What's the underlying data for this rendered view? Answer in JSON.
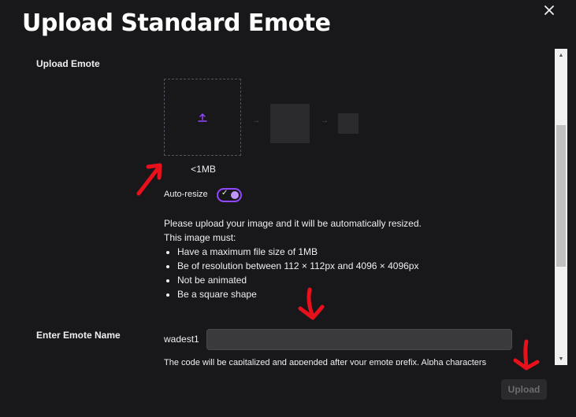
{
  "modal": {
    "title": "Upload Standard Emote",
    "close_icon": "close-icon"
  },
  "upload_section": {
    "label": "Upload Emote",
    "upload_icon": "upload-arrow-icon",
    "size_limit": "<1MB",
    "auto_resize": {
      "label": "Auto-resize",
      "enabled": true,
      "check_icon": "checkmark-icon"
    },
    "instructions": {
      "intro": "Please upload your image and it will be automatically resized.",
      "must_heading": "This image must:",
      "requirements": [
        "Have a maximum file size of 1MB",
        "Be of resolution between 112 × 112px and 4096 × 4096px",
        "Not be animated",
        "Be a square shape"
      ]
    }
  },
  "name_section": {
    "label": "Enter Emote Name",
    "prefix": "wadest1",
    "value": "",
    "placeholder": "",
    "help_text": "The code will be capitalized and appended after your emote prefix. Alpha characters"
  },
  "footer": {
    "upload_label": "Upload"
  },
  "colors": {
    "background": "#18181b",
    "accent": "#9147ff",
    "accent_light": "#bf94ff",
    "annotation_red": "#e8101b"
  }
}
